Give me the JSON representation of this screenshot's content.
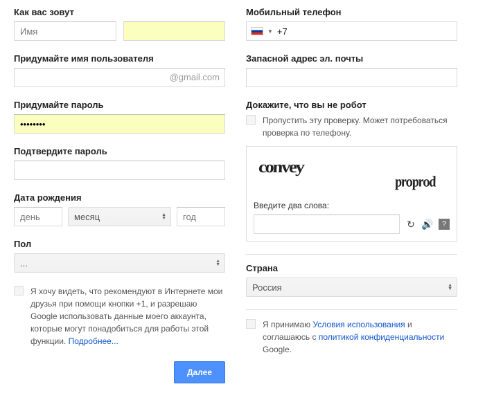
{
  "left": {
    "name_label": "Как вас зовут",
    "first_name_placeholder": "Имя",
    "username_label": "Придумайте имя пользователя",
    "username_suffix": "@gmail.com",
    "password_label": "Придумайте пароль",
    "password_value": "••••••••",
    "confirm_label": "Подтвердите пароль",
    "dob_label": "Дата рождения",
    "dob_day": "день",
    "dob_month": "месяц",
    "dob_year": "год",
    "gender_label": "Пол",
    "gender_value": "...",
    "plusone_text1": "Я хочу видеть, что рекомендуют в Интернете мои друзья при помощи кнопки +1, и разрешаю Google использовать данные моего аккаунта, которые могут понадобиться для работы этой функции. ",
    "plusone_link": "Подробнее...",
    "next_button": "Далее"
  },
  "right": {
    "phone_label": "Мобильный телефон",
    "phone_prefix": "+7",
    "recovery_label": "Запасной адрес эл. почты",
    "robot_label": "Докажите, что вы не робот",
    "skip_text": "Пропустить эту проверку. Может потребоваться проверка по телефону.",
    "captcha_word1": "convey",
    "captcha_word2": "proprod",
    "captcha_label": "Введите два слова:",
    "country_label": "Страна",
    "country_value": "Россия",
    "tos_part1": "Я принимаю ",
    "tos_link1": "Условия использования",
    "tos_part2": " и соглашаюсь с ",
    "tos_link2": "политикой конфиденциальности",
    "tos_part3": " Google."
  }
}
